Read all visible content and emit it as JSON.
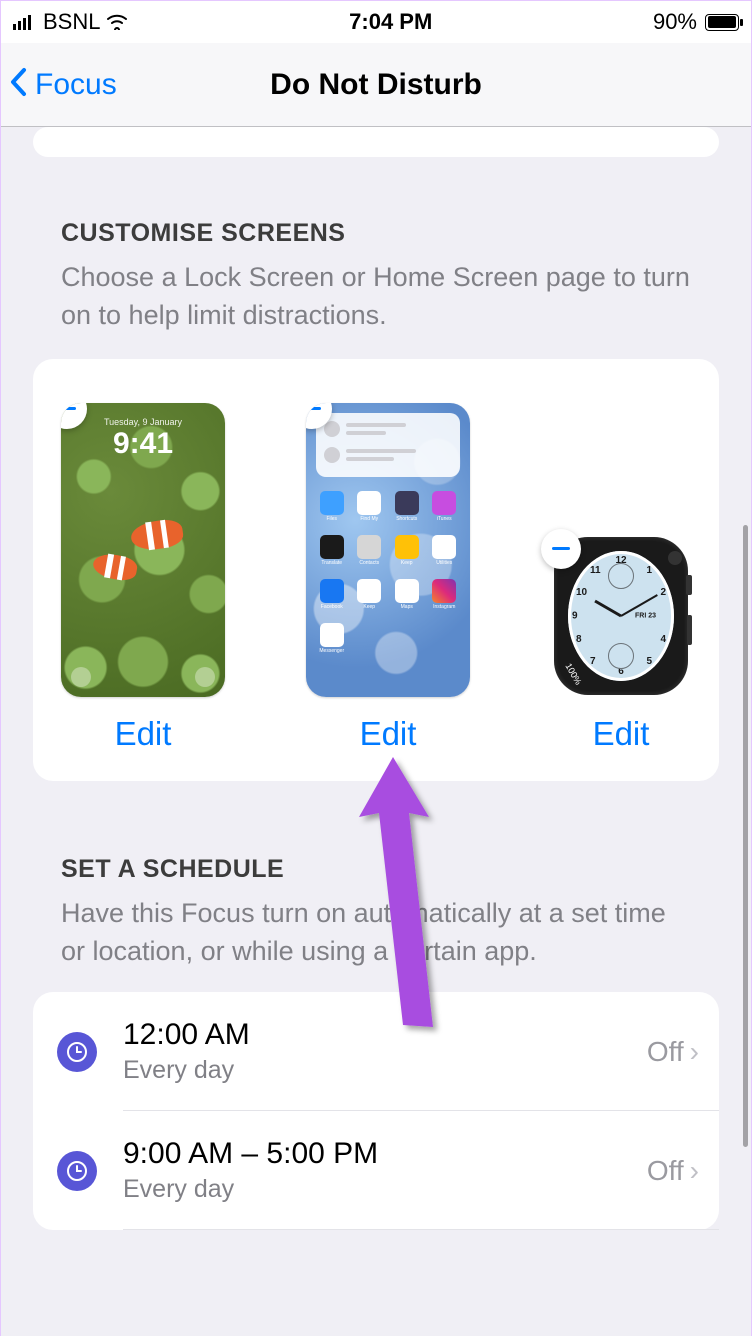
{
  "status": {
    "carrier": "BSNL",
    "time": "7:04 PM",
    "battery_pct": "90%"
  },
  "nav": {
    "back_label": "Focus",
    "title": "Do Not Disturb"
  },
  "customise": {
    "header": "CUSTOMISE SCREENS",
    "description": "Choose a Lock Screen or Home Screen page to turn on to help limit distractions.",
    "lock_day": "Tuesday, 9 January",
    "lock_time": "9:41",
    "watch_pct": "100%",
    "watch_date": "FRI 23",
    "edit_label": "Edit"
  },
  "schedule": {
    "header": "SET A SCHEDULE",
    "description": "Have this Focus turn on automatically at a set time or location, or while using a certain app.",
    "rows": [
      {
        "time": "12:00 AM",
        "sub": "Every day",
        "state": "Off"
      },
      {
        "time": "9:00 AM – 5:00 PM",
        "sub": "Every day",
        "state": "Off"
      }
    ]
  }
}
